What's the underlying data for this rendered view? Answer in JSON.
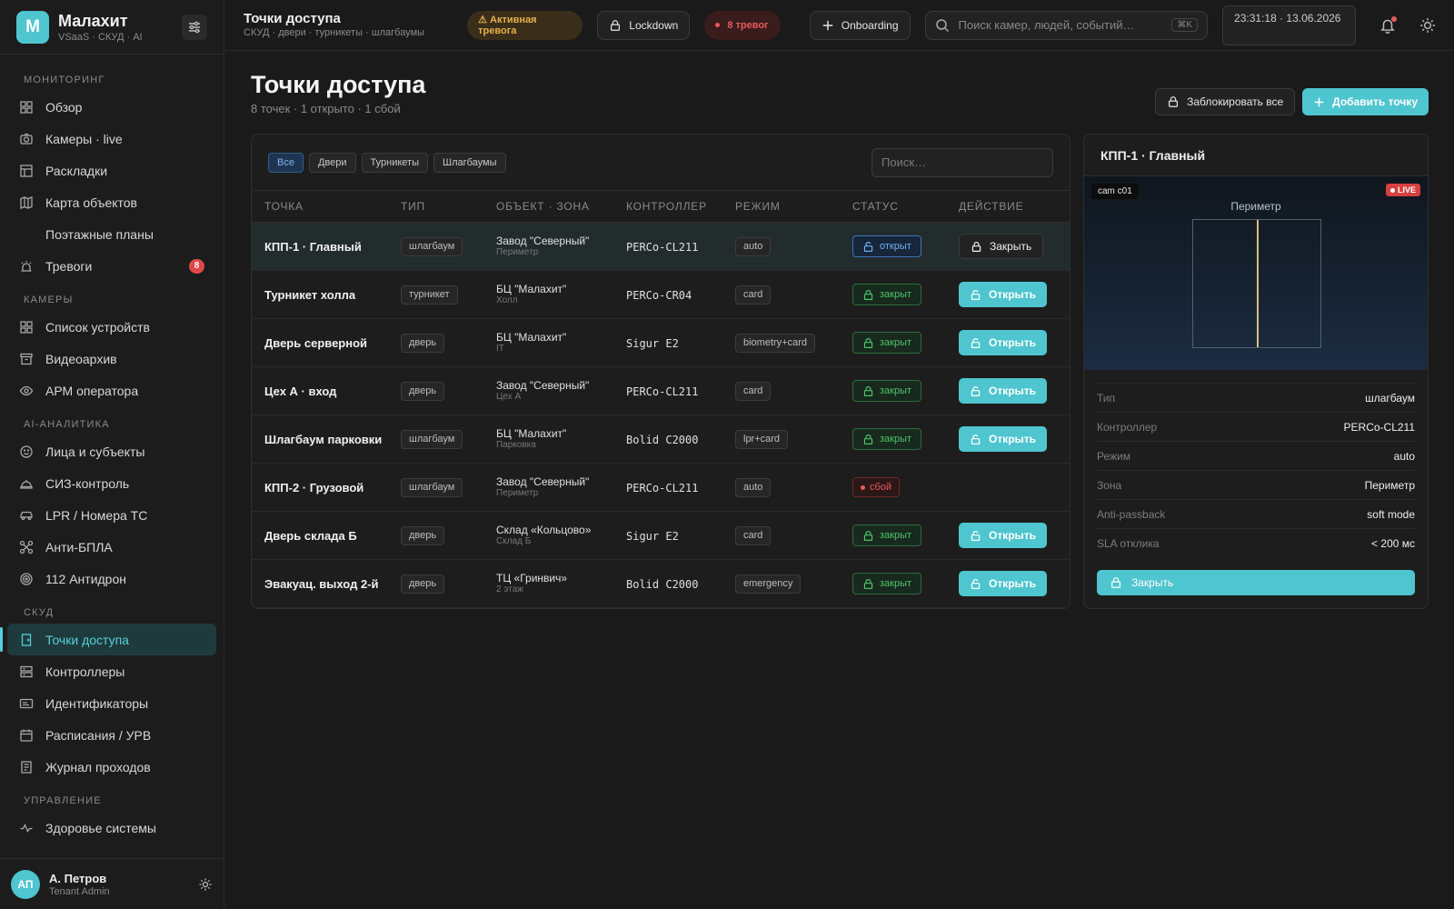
{
  "brand": {
    "logo": "M",
    "name": "Малахит",
    "sub": "VSaaS · СКУД · AI"
  },
  "nav": {
    "monitoring": "Мониторинг",
    "overview": "Обзор",
    "cameras_live": "Камеры · live",
    "layouts": "Раскладки",
    "map": "Карта объектов",
    "floor_plans": "Поэтажные планы",
    "alarms": "Тревоги",
    "alarms_count": "8",
    "cameras": "Камеры",
    "device_list": "Список устройств",
    "archive": "Видеоархив",
    "operator": "АРМ оператора",
    "ai": "AI-аналитика",
    "faces": "Лица и субъекты",
    "ppe": "СИЗ-контроль",
    "lpr": "LPR / Номера ТС",
    "anti_uav": "Анти-БПЛА",
    "antidrone": "112 Антидрон",
    "acs": "СКУД",
    "access_points": "Точки доступа",
    "controllers": "Контроллеры",
    "identifiers": "Идентификаторы",
    "schedules": "Расписания / УРВ",
    "journal": "Журнал проходов",
    "management": "Управление",
    "health": "Здоровье системы"
  },
  "user": {
    "initials": "АП",
    "name": "А. Петров",
    "role": "Tenant Admin"
  },
  "topbar": {
    "title": "Точки доступа",
    "crumb": "СКУД · двери · турникеты · шлагбаумы",
    "alarm_pill": "⚠ Активная тревога",
    "lockdown": "Lockdown",
    "alerts": "8 тревог",
    "onboarding": "Onboarding",
    "search_placeholder": "Поиск камер, людей, событий…",
    "kbd": "⌘K",
    "clock": "23:31:18 · 13.06.2026"
  },
  "page": {
    "title": "Точки доступа",
    "subtitle": "8 точек · 1 открыто · 1 сбой",
    "lock_all": "Заблокировать все",
    "add_point": "Добавить точку"
  },
  "filters": {
    "all": "Все",
    "doors": "Двери",
    "turnstiles": "Турникеты",
    "barriers": "Шлагбаумы",
    "search_placeholder": "Поиск…"
  },
  "columns": {
    "point": "ТОЧКА",
    "type": "ТИП",
    "object": "ОБЪЕКТ · ЗОНА",
    "controller": "КОНТРОЛЛЕР",
    "mode": "РЕЖИМ",
    "status": "СТАТУС",
    "action": "ДЕЙСТВИЕ"
  },
  "rows": [
    {
      "name": "КПП-1 · Главный",
      "type": "шлагбаум",
      "object": "Завод \"Северный\"",
      "zone": "Периметр",
      "controller": "PERCo-CL211",
      "mode": "auto",
      "status": "открыт",
      "action": "Закрыть"
    },
    {
      "name": "Турникет холла",
      "type": "турникет",
      "object": "БЦ \"Малахит\"",
      "zone": "Холл",
      "controller": "PERCo-CR04",
      "mode": "card",
      "status": "закрыт",
      "action": "Открыть"
    },
    {
      "name": "Дверь серверной",
      "type": "дверь",
      "object": "БЦ \"Малахит\"",
      "zone": "IT",
      "controller": "Sigur E2",
      "mode": "biometry+card",
      "status": "закрыт",
      "action": "Открыть"
    },
    {
      "name": "Цех А · вход",
      "type": "дверь",
      "object": "Завод \"Северный\"",
      "zone": "Цех А",
      "controller": "PERCo-CL211",
      "mode": "card",
      "status": "закрыт",
      "action": "Открыть"
    },
    {
      "name": "Шлагбаум парковки",
      "type": "шлагбаум",
      "object": "БЦ \"Малахит\"",
      "zone": "Парковка",
      "controller": "Bolid C2000",
      "mode": "lpr+card",
      "status": "закрыт",
      "action": "Открыть"
    },
    {
      "name": "КПП-2 · Грузовой",
      "type": "шлагбаум",
      "object": "Завод \"Северный\"",
      "zone": "Периметр",
      "controller": "PERCo-CL211",
      "mode": "auto",
      "status": "сбой",
      "action": ""
    },
    {
      "name": "Дверь склада Б",
      "type": "дверь",
      "object": "Склад «Кольцово»",
      "zone": "Склад Б",
      "controller": "Sigur E2",
      "mode": "card",
      "status": "закрыт",
      "action": "Открыть"
    },
    {
      "name": "Эвакуац. выход 2-й",
      "type": "дверь",
      "object": "ТЦ «Гринвич»",
      "zone": "2 этаж",
      "controller": "Bolid C2000",
      "mode": "emergency",
      "status": "закрыт",
      "action": "Открыть"
    }
  ],
  "detail": {
    "title": "КПП-1 · Главный",
    "cam_label": "cam c01",
    "live": "LIVE",
    "cam_zone": "Периметр",
    "props": [
      {
        "k": "Тип",
        "v": "шлагбаум"
      },
      {
        "k": "Контроллер",
        "v": "PERCo-CL211"
      },
      {
        "k": "Режим",
        "v": "auto"
      },
      {
        "k": "Зона",
        "v": "Периметр"
      },
      {
        "k": "Anti-passback",
        "v": "soft mode"
      },
      {
        "k": "SLA отклика",
        "v": "< 200 мс"
      }
    ],
    "button": "Закрыть"
  },
  "colors": {
    "accent": "#4ec5cf",
    "alert": "#e65b5b",
    "ok": "#4fc16b",
    "open": "#6fb0f5"
  }
}
